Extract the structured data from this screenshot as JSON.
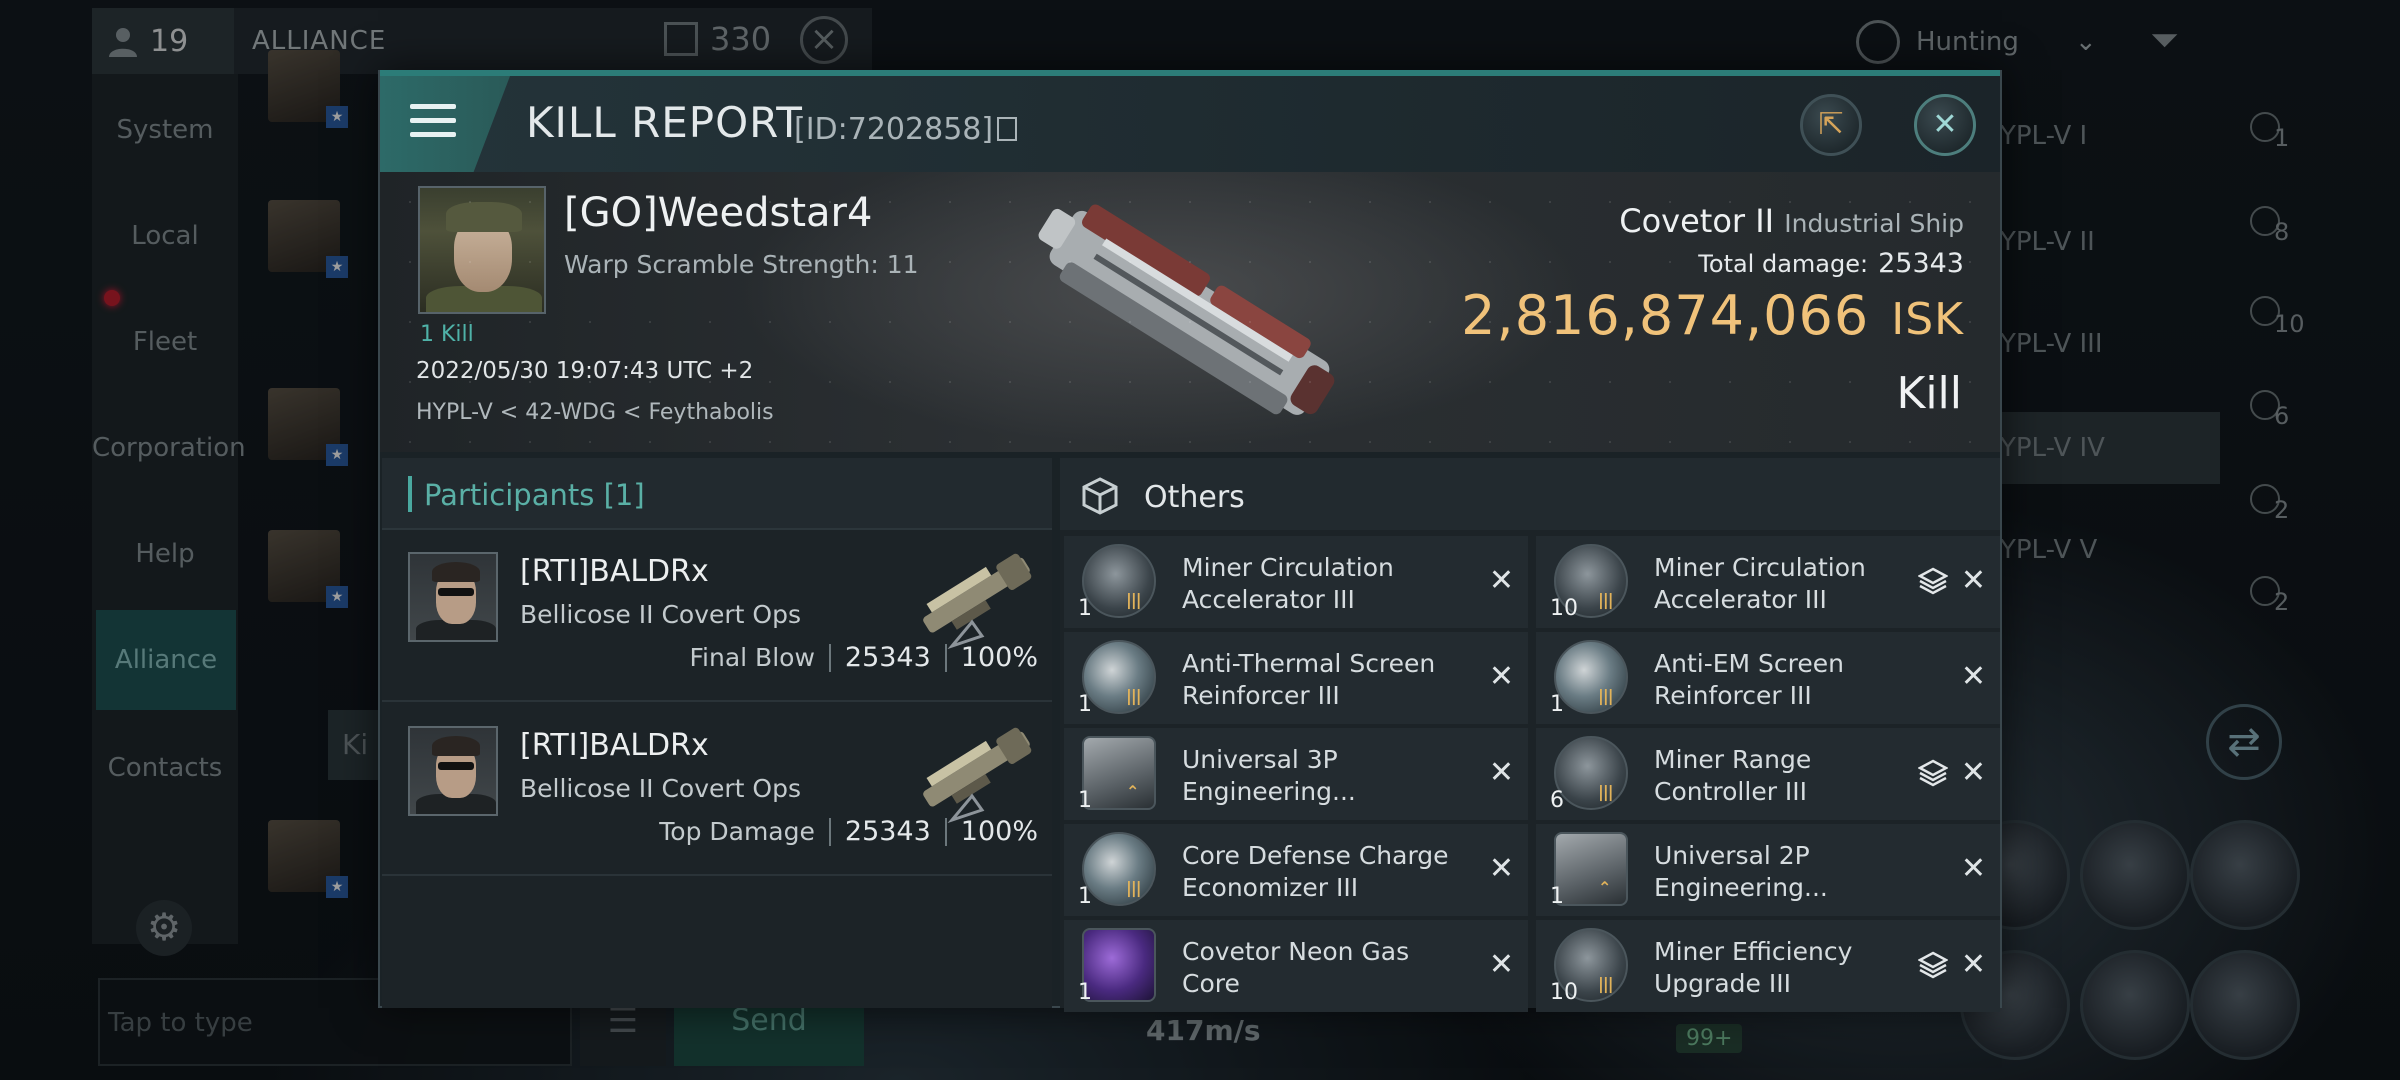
{
  "background": {
    "chat": {
      "member_count": "19",
      "title": "ALLIANCE",
      "message_count": "330",
      "sidebar": [
        "System",
        "Local",
        "Fleet",
        "Corporation",
        "Help",
        "Alliance",
        "Contacts"
      ],
      "active_tab": "Alliance",
      "partial_chip": "Ki",
      "input_placeholder": "Tap to type",
      "send_label": "Send"
    },
    "hud": {
      "mode": "Hunting",
      "overview_items": [
        "YPL-V I",
        "YPL-V II",
        "YPL-V III",
        "YPL-V IV",
        "YPL-V V"
      ],
      "overview_counts": [
        "1",
        "8",
        "10",
        "6",
        "2",
        "2"
      ],
      "speed": "417m/s",
      "badge": "99+"
    }
  },
  "report": {
    "title": "KILL REPORT",
    "id": "[ID:7202858]",
    "victim": {
      "name": "[GO]Weedstar4",
      "warp": "Warp Scramble Strength: 11",
      "kills": "1 Kill",
      "datetime": "2022/05/30 19:07:43 UTC +2",
      "location": "HYPL-V < 42-WDG < Feythabolis"
    },
    "ship": {
      "name": "Covetor II",
      "class": "Industrial Ship",
      "total_damage_label": "Total damage:",
      "total_damage": "25343",
      "isk_value": "2,816,874,066",
      "isk_unit": "ISK",
      "result": "Kill"
    },
    "participants": {
      "heading": "Participants [1]",
      "rows": [
        {
          "name": "[RTI]BALDRx",
          "ship": "Bellicose II Covert Ops",
          "label": "Final Blow",
          "damage": "25343",
          "percent": "100%"
        },
        {
          "name": "[RTI]BALDRx",
          "ship": "Bellicose II Covert Ops",
          "label": "Top Damage",
          "damage": "25343",
          "percent": "100%"
        }
      ]
    },
    "others": {
      "heading": "Others",
      "items": [
        {
          "name": "Miner Circulation Accelerator III",
          "qty": "1",
          "icon": "circulation-icon",
          "stack": false
        },
        {
          "name": "Miner Circulation Accelerator III",
          "qty": "10",
          "icon": "circulation-icon",
          "stack": true
        },
        {
          "name": "Anti-Thermal Screen Reinforcer III",
          "qty": "1",
          "icon": "shield-icon",
          "stack": false
        },
        {
          "name": "Anti-EM Screen Reinforcer III",
          "qty": "1",
          "icon": "shield-icon",
          "stack": false
        },
        {
          "name": "Universal 3P Engineering...",
          "qty": "1",
          "icon": "engineering-icon",
          "stack": false
        },
        {
          "name": "Miner Range Controller III",
          "qty": "6",
          "icon": "range-icon",
          "stack": true
        },
        {
          "name": "Core Defense Charge Economizer III",
          "qty": "1",
          "icon": "shield-icon",
          "stack": false
        },
        {
          "name": "Universal 2P Engineering...",
          "qty": "1",
          "icon": "engineering-icon",
          "stack": false
        },
        {
          "name": "Covetor Neon Gas Core",
          "qty": "1",
          "icon": "gas-core-icon",
          "stack": false
        },
        {
          "name": "Miner Efficiency Upgrade III",
          "qty": "10",
          "icon": "efficiency-icon",
          "stack": true
        }
      ]
    }
  }
}
